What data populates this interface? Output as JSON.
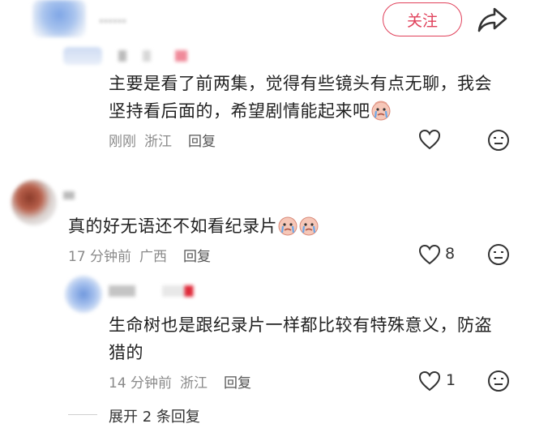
{
  "header": {
    "username": "……",
    "follow_label": "关注",
    "share_icon": "share-arrow-icon"
  },
  "comments": [
    {
      "text": "主要是看了前两集，觉得有些镜头有点无聊，我会坚持看后面的，希望剧情能起来吧",
      "emoji": "crying-face",
      "time": "刚刚",
      "location": "浙江",
      "reply_label": "回复",
      "likes": ""
    },
    {
      "text": "真的好无语还不如看纪录片",
      "emoji": "crying-face-x2",
      "time": "17 分钟前",
      "location": "广西",
      "reply_label": "回复",
      "likes": "8"
    },
    {
      "text": "生命树也是跟纪录片一样都比较有特殊意义，防盗猎的",
      "time": "14 分钟前",
      "location": "浙江",
      "reply_label": "回复",
      "likes": "1"
    }
  ],
  "expand_label": "展开 2 条回复",
  "colors": {
    "accent": "#e0405a",
    "muted": "#8a8a8a"
  }
}
